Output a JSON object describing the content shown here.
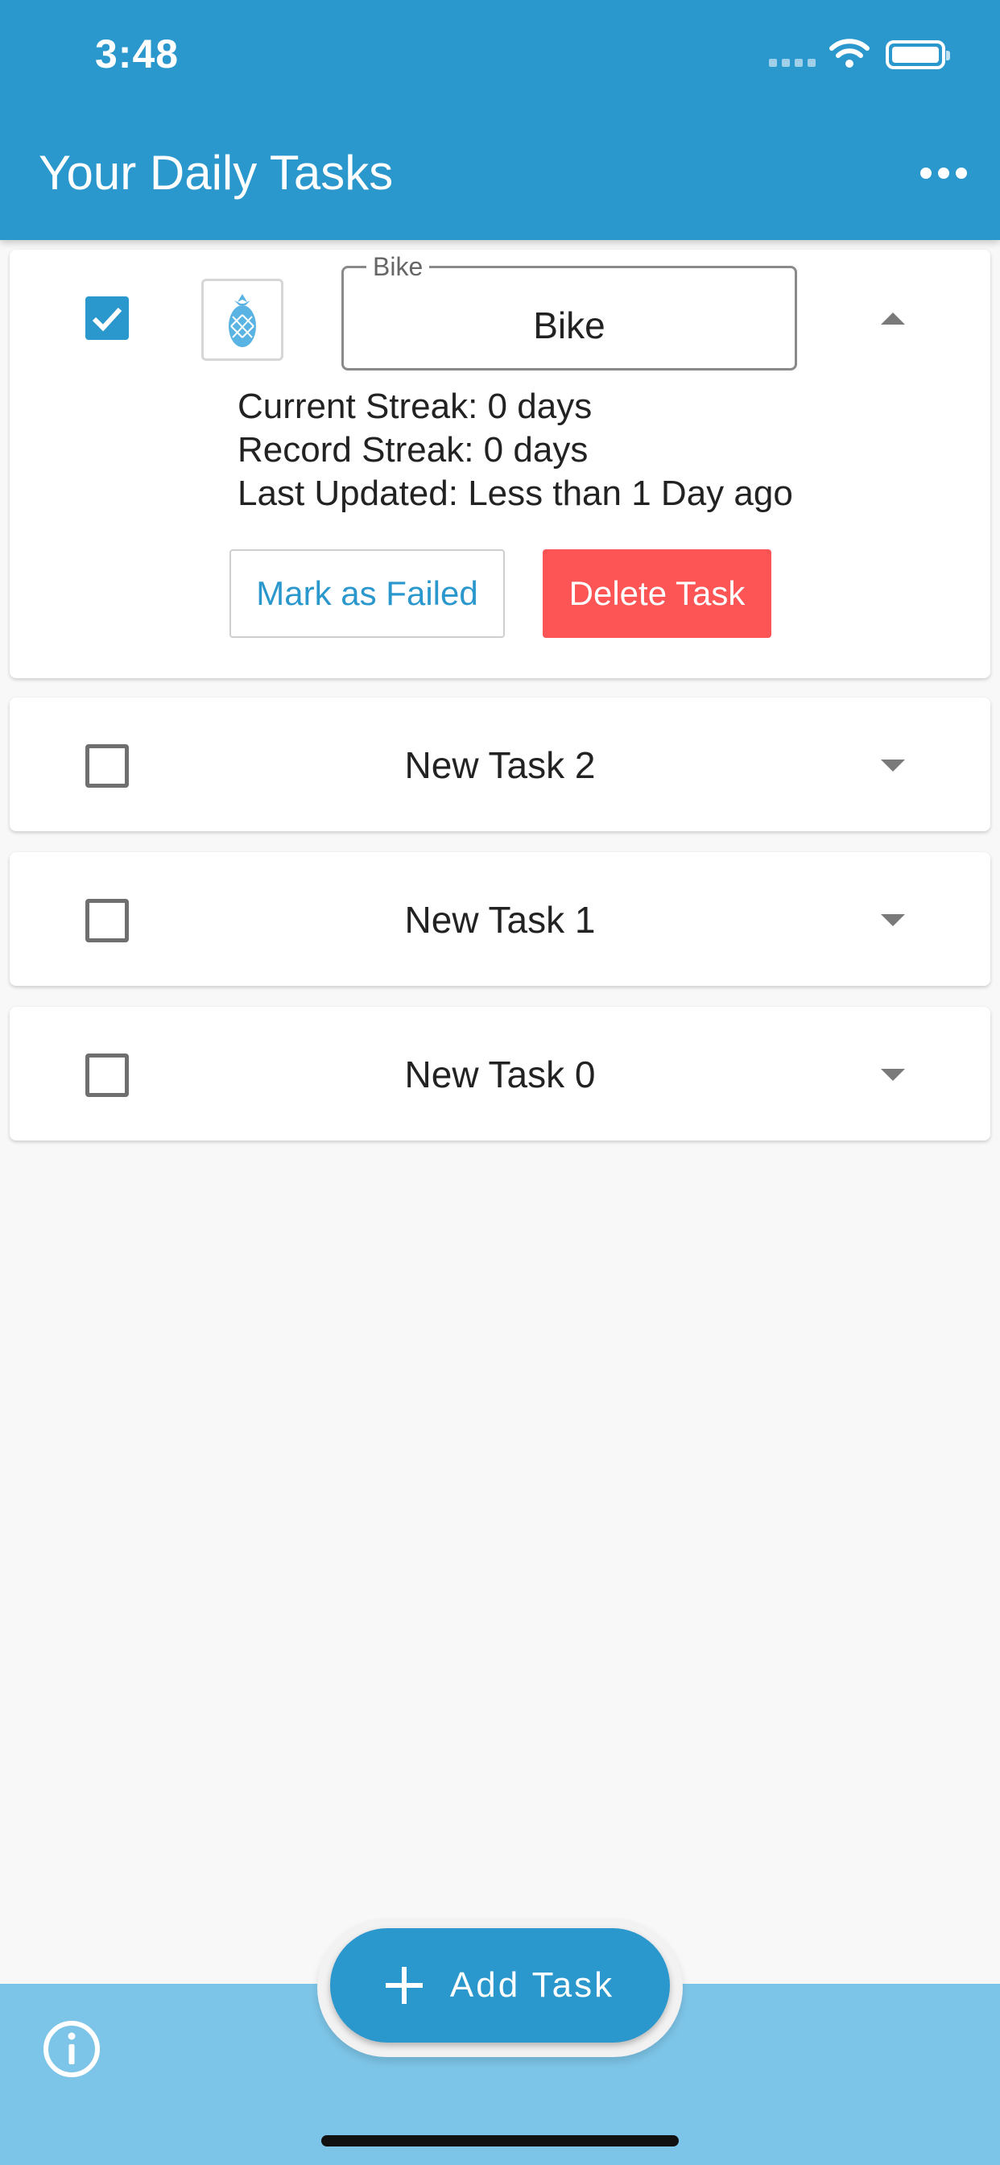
{
  "status_bar": {
    "time": "3:48"
  },
  "app_bar": {
    "title": "Your Daily Tasks"
  },
  "expanded_task": {
    "checked": true,
    "field_label": "Bike",
    "name": "Bike",
    "current_streak": "Current Streak: 0 days",
    "record_streak": "Record Streak: 0 days",
    "last_updated": "Last Updated: Less than 1 Day ago",
    "mark_failed_label": "Mark as Failed",
    "delete_label": "Delete Task"
  },
  "tasks": [
    {
      "name": "New Task 2",
      "checked": false
    },
    {
      "name": "New Task 1",
      "checked": false
    },
    {
      "name": "New Task 0",
      "checked": false
    }
  ],
  "fab": {
    "label": "Add Task"
  },
  "colors": {
    "primary": "#2a97cd",
    "bottom_bar": "#7dc5e8",
    "danger": "#fd5556",
    "background": "#f8f8f8"
  },
  "icons": {
    "menu": "more-horizontal-icon",
    "task_icon": "pineapple-icon",
    "info": "info-icon",
    "add": "plus-icon"
  }
}
